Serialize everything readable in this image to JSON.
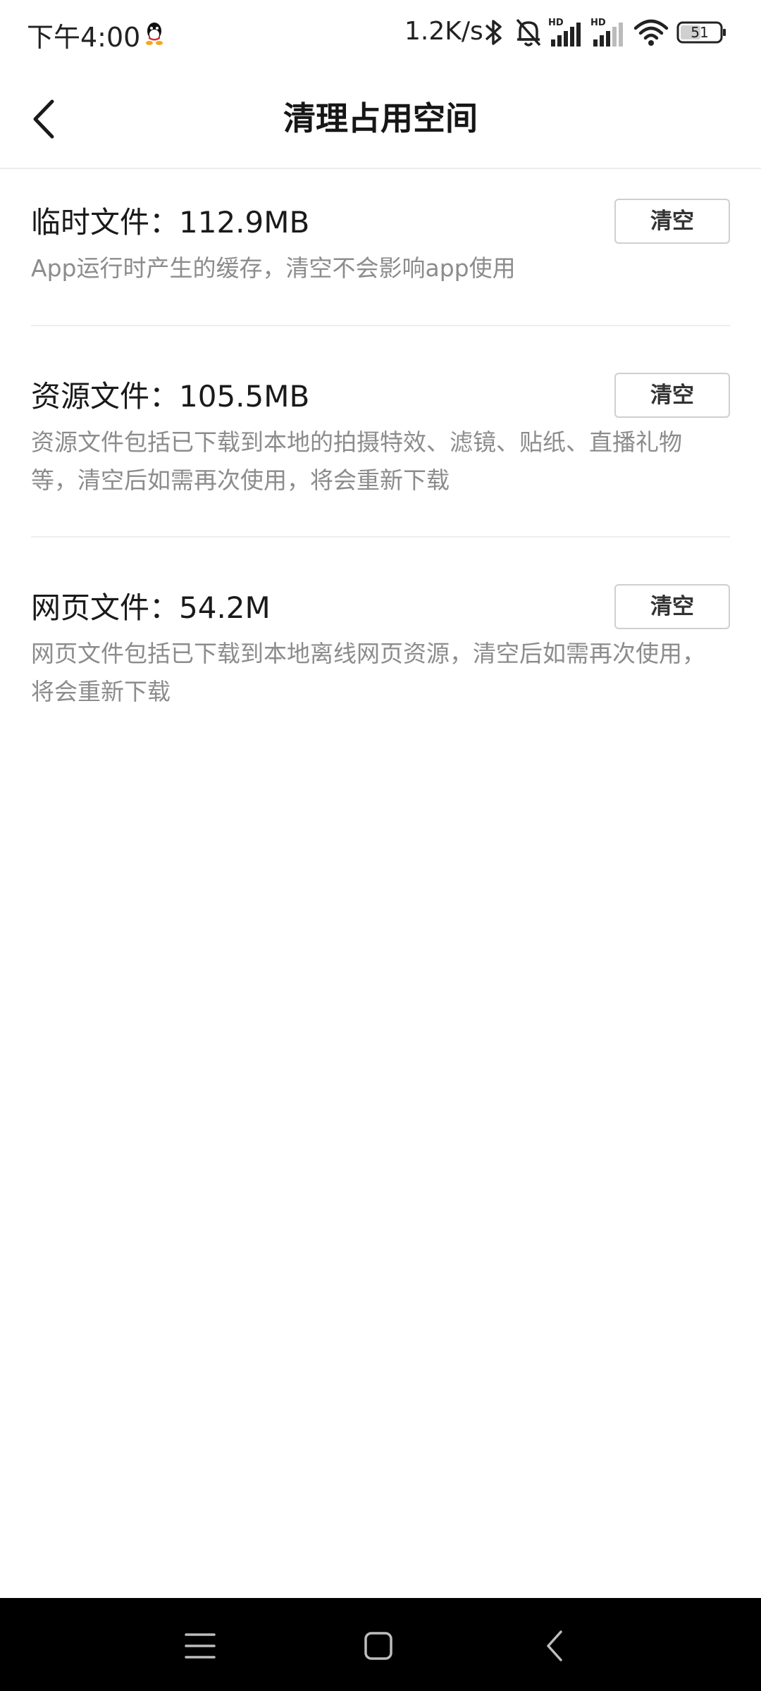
{
  "status_bar": {
    "time": "下午4:00",
    "net_speed": "1.2K/s",
    "battery": "51",
    "icons": [
      "qq-icon",
      "bluetooth-icon",
      "silent-bell-icon",
      "hd-signal-icon",
      "hd-signal-icon",
      "wifi-icon",
      "battery-icon"
    ]
  },
  "header": {
    "title": "清理占用空间",
    "back_icon": "back-arrow-icon"
  },
  "sections": [
    {
      "title": "临时文件：112.9MB",
      "description": "App运行时产生的缓存，清空不会影响app使用",
      "button_label": "清空"
    },
    {
      "title": "资源文件：105.5MB",
      "description": "资源文件包括已下载到本地的拍摄特效、滤镜、贴纸、直播礼物等，清空后如需再次使用，将会重新下载",
      "button_label": "清空"
    },
    {
      "title": "网页文件：54.2M",
      "description": "网页文件包括已下载到本地离线网页资源，清空后如需再次使用，将会重新下载",
      "button_label": "清空"
    }
  ],
  "nav_bar": {
    "icons": [
      "menu-icon",
      "home-icon",
      "back-icon"
    ]
  },
  "colors": {
    "title_text": "#161616",
    "desc_text": "#8c8c8c",
    "button_border": "#cfcfcf",
    "nav_bg": "#000000"
  }
}
